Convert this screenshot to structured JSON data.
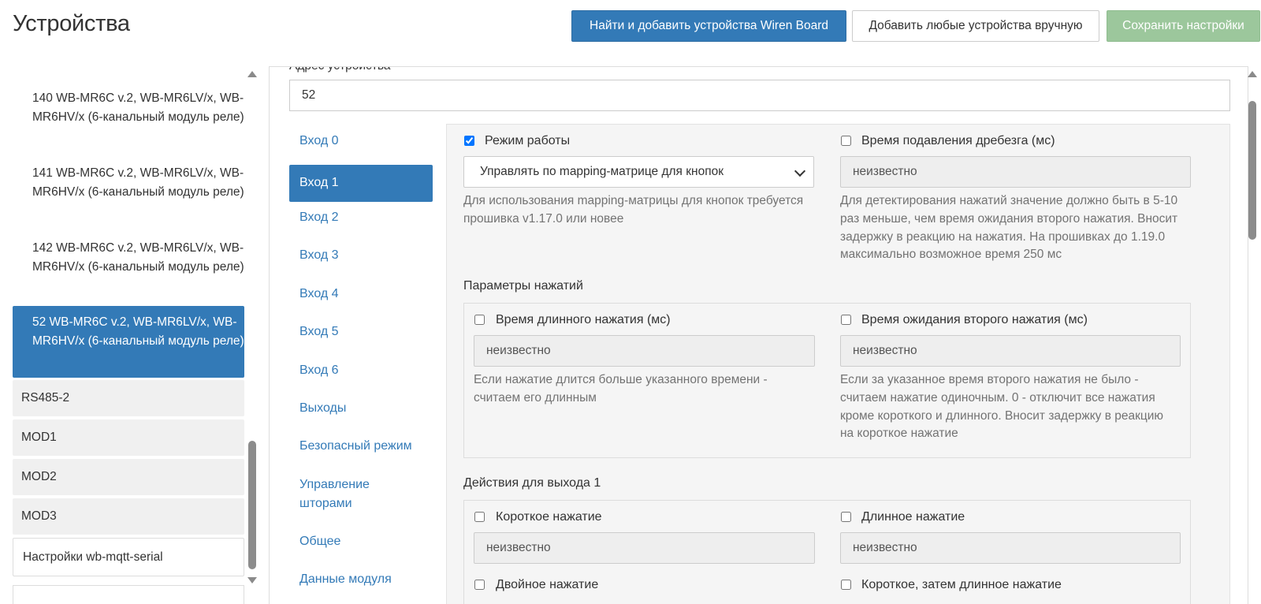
{
  "header": {
    "title": "Устройства",
    "buttons": {
      "scan": "Найти и добавить устройства Wiren Board",
      "add_manual": "Добавить любые устройства вручную",
      "save": "Сохранить настройки"
    }
  },
  "sidebar": {
    "devices": [
      {
        "label": "140 WB-MR6C v.2, WB-MR6LV/x, WB-MR6HV/x (6-канальный модуль реле)"
      },
      {
        "label": "141 WB-MR6C v.2, WB-MR6LV/x, WB-MR6HV/x (6-канальный модуль реле)"
      },
      {
        "label": "142 WB-MR6C v.2, WB-MR6LV/x, WB-MR6HV/x (6-канальный модуль реле)"
      },
      {
        "label": "52 WB-MR6C v.2, WB-MR6LV/x, WB-MR6HV/x (6-канальный модуль реле)",
        "active": true
      }
    ],
    "ports": [
      "RS485-2",
      "MOD1",
      "MOD2",
      "MOD3"
    ],
    "settings": "Настройки wb-mqtt-serial"
  },
  "device": {
    "address_label": "Адрес устройства",
    "address_value": "52"
  },
  "tabs": [
    {
      "label": "Вход 0"
    },
    {
      "label": "Вход 1",
      "active": true
    },
    {
      "label": "Вход 2"
    },
    {
      "label": "Вход 3"
    },
    {
      "label": "Вход 4"
    },
    {
      "label": "Вход 5"
    },
    {
      "label": "Вход 6"
    },
    {
      "label": "Выходы"
    },
    {
      "label": "Безопасный режим"
    },
    {
      "label": "Управление шторами"
    },
    {
      "label": "Общее"
    },
    {
      "label": "Данные модуля"
    }
  ],
  "form": {
    "mode": {
      "label": "Режим работы",
      "checked": true,
      "selected": "Управлять по mapping-матрице для кнопок",
      "help": "Для использования mapping-матрицы для кнопок требуется прошивка v1.17.0 или новее"
    },
    "debounce": {
      "label": "Время подавления дребезга (мс)",
      "checked": false,
      "value": "неизвестно",
      "help": "Для детектирования нажатий значение должно быть в 5-10 раз меньше, чем время ожидания второго нажатия. Вносит задержку в реакцию на нажатия. На прошивках до 1.19.0 максимально возможное время 250 мс"
    },
    "press_params": {
      "title": "Параметры нажатий",
      "long_press": {
        "label": "Время длинного нажатия (мс)",
        "checked": false,
        "value": "неизвестно",
        "help": "Если нажатие длится больше указанного времени - считаем его длинным"
      },
      "second_press": {
        "label": "Время ожидания второго нажатия (мс)",
        "checked": false,
        "value": "неизвестно",
        "help": "Если за указанное время второго нажатия не было - считаем нажатие одиночным. 0 - отключит все нажатия кроме короткого и длинного. Вносит задержку в реакцию на короткое нажатие"
      }
    },
    "actions": {
      "title": "Действия для выхода 1",
      "short": {
        "label": "Короткое нажатие",
        "checked": false,
        "value": "неизвестно"
      },
      "long": {
        "label": "Длинное нажатие",
        "checked": false,
        "value": "неизвестно"
      },
      "double": {
        "label": "Двойное нажатие",
        "checked": false
      },
      "short_long": {
        "label": "Короткое, затем длинное нажатие",
        "checked": false
      }
    }
  },
  "colors": {
    "primary": "#337ab7",
    "success_disabled": "#9cc79c",
    "panel_bg": "#f5f5f5",
    "readonly_bg": "#eeeeee",
    "help_text": "#737373"
  }
}
